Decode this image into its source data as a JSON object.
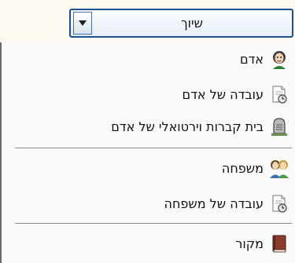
{
  "dropdown": {
    "selected": "שיוך",
    "arrow_icon": "chevron-down-icon"
  },
  "menu": {
    "items": [
      {
        "label": "אדם",
        "icon": "person-icon"
      },
      {
        "label": "עובדה של אדם",
        "icon": "person-fact-icon"
      },
      {
        "label": "בית קברות וירטואלי של אדם",
        "icon": "tombstone-icon"
      },
      {
        "label": "משפחה",
        "icon": "family-icon"
      },
      {
        "label": "עובדה של משפחה",
        "icon": "family-fact-icon"
      },
      {
        "label": "מקור",
        "icon": "source-book-icon"
      }
    ]
  }
}
